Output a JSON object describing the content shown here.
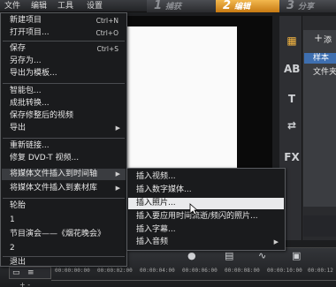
{
  "menubar": {
    "items": [
      "文件",
      "编辑",
      "工具",
      "设置"
    ]
  },
  "steps": [
    {
      "num": "1",
      "label": "捕获"
    },
    {
      "num": "2",
      "label": "编辑"
    },
    {
      "num": "3",
      "label": "分享"
    }
  ],
  "file_menu": {
    "items": [
      {
        "label": "新建项目",
        "shortcut": "Ctrl+N"
      },
      {
        "label": "打开项目...",
        "shortcut": "Ctrl+O"
      },
      {
        "label": "保存",
        "shortcut": "Ctrl+S"
      },
      {
        "label": "另存为..."
      },
      {
        "label": "导出为模板..."
      },
      {
        "label": "智能包..."
      },
      {
        "label": "成批转换..."
      },
      {
        "label": "保存修整后的视频"
      },
      {
        "label": "导出",
        "submenu": true
      },
      {
        "label": "重新链接..."
      },
      {
        "label": "修复 DVD-T 视频..."
      },
      {
        "label": "将媒体文件插入到时间轴",
        "submenu": true
      },
      {
        "label": "将媒体文件插入到素材库",
        "submenu": true
      },
      {
        "label": "轮胎"
      },
      {
        "label": "1"
      },
      {
        "label": "节目演会——《烟花晚会》"
      },
      {
        "label": "2"
      },
      {
        "label": "退出"
      }
    ]
  },
  "submenu": {
    "items": [
      {
        "label": "插入视频..."
      },
      {
        "label": "插入数字媒体..."
      },
      {
        "label": "插入照片..."
      },
      {
        "label": "插入要应用时间流逝/频闪的照片..."
      },
      {
        "label": "插入字幕..."
      },
      {
        "label": "插入音频",
        "submenu": true
      }
    ]
  },
  "library": {
    "add_icon": "+",
    "add_label": "添",
    "items": [
      "样本",
      "文件夹"
    ],
    "tool_icons": [
      "media-icon",
      "instant-project-icon",
      "title-icon",
      "transition-icon",
      "fx-icon"
    ]
  },
  "timeline": {
    "ticks": [
      "00:00:00:00",
      "00:00:02:00",
      "00:00:04:00",
      "00:00:06:00",
      "00:00:08:00",
      "00:00:10:00",
      "00:00:12"
    ],
    "zoom_label": "+   -"
  },
  "colors": {
    "active_step": "#e8a030",
    "highlight": "#e9eaec"
  }
}
